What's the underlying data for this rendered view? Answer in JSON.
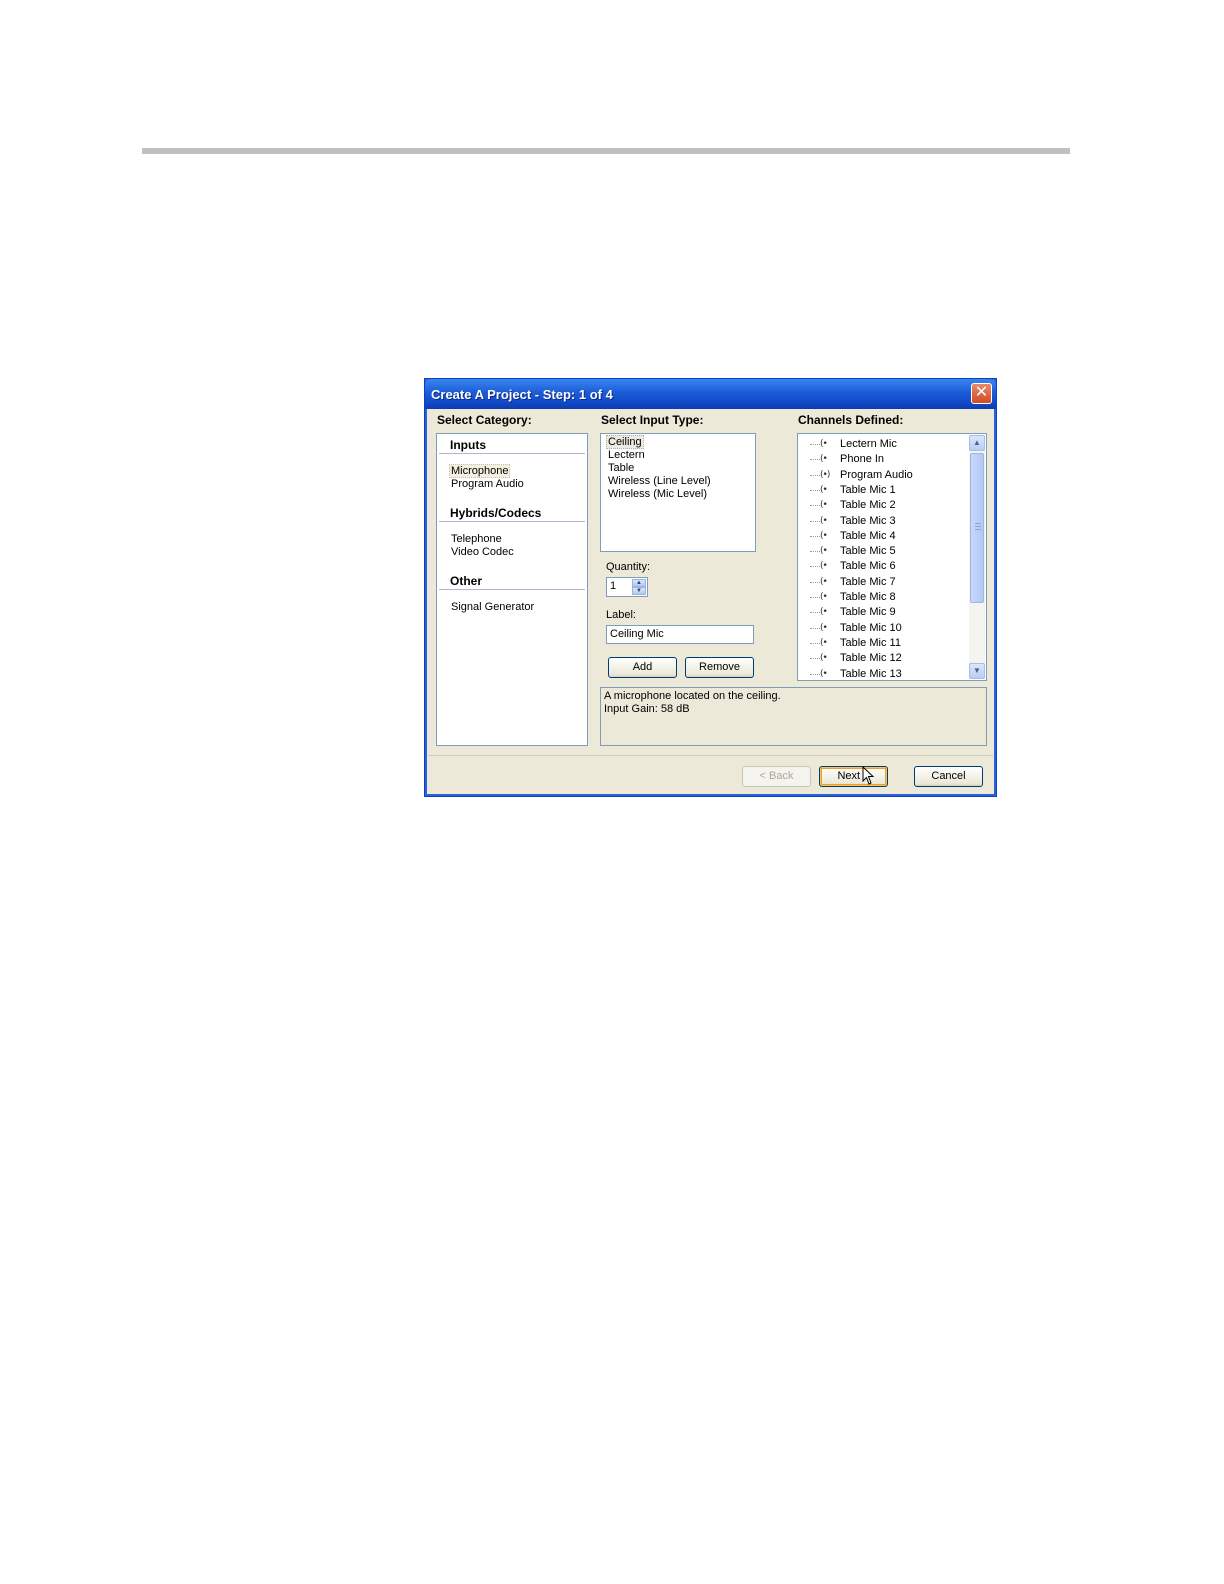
{
  "dialog": {
    "title": "Create A Project - Step: 1 of 4",
    "close_label": "✕"
  },
  "category": {
    "heading": "Select Category:",
    "groups": [
      {
        "name": "Inputs",
        "items": [
          "Microphone",
          "Program Audio"
        ]
      },
      {
        "name": "Hybrids/Codecs",
        "items": [
          "Telephone",
          "Video Codec"
        ]
      },
      {
        "name": "Other",
        "items": [
          "Signal Generator"
        ]
      }
    ],
    "selected": "Microphone"
  },
  "input_type": {
    "heading": "Select Input Type:",
    "items": [
      "Ceiling",
      "Lectern",
      "Table",
      "Wireless (Line Level)",
      "Wireless (Mic Level)"
    ],
    "selected": "Ceiling"
  },
  "quantity": {
    "label": "Quantity:",
    "value": "1"
  },
  "label_field": {
    "label": "Label:",
    "value": "Ceiling Mic"
  },
  "buttons": {
    "add": "Add",
    "remove": "Remove",
    "back": "< Back",
    "next": "Next >",
    "cancel": "Cancel"
  },
  "channels": {
    "heading": "Channels Defined:",
    "items": [
      {
        "name": "Lectern Mic",
        "icon": "(•"
      },
      {
        "name": "Phone In",
        "icon": "(•"
      },
      {
        "name": "Program Audio",
        "icon": "(•)"
      },
      {
        "name": "Table Mic 1",
        "icon": "(•"
      },
      {
        "name": "Table Mic 2",
        "icon": "(•"
      },
      {
        "name": "Table Mic 3",
        "icon": "(•"
      },
      {
        "name": "Table Mic 4",
        "icon": "(•"
      },
      {
        "name": "Table Mic 5",
        "icon": "(•"
      },
      {
        "name": "Table Mic 6",
        "icon": "(•"
      },
      {
        "name": "Table Mic 7",
        "icon": "(•"
      },
      {
        "name": "Table Mic 8",
        "icon": "(•"
      },
      {
        "name": "Table Mic 9",
        "icon": "(•"
      },
      {
        "name": "Table Mic 10",
        "icon": "(•"
      },
      {
        "name": "Table Mic 11",
        "icon": "(•"
      },
      {
        "name": "Table Mic 12",
        "icon": "(•"
      },
      {
        "name": "Table Mic 13",
        "icon": "(•"
      }
    ]
  },
  "description": {
    "line1": "A microphone located on the ceiling.",
    "line2": "Input Gain: 58 dB"
  },
  "colors": {
    "title_bar": "#1c5bd8",
    "dialog_bg": "#ece9d8",
    "field_border": "#7f9db9",
    "close_button": "#d34a22"
  }
}
